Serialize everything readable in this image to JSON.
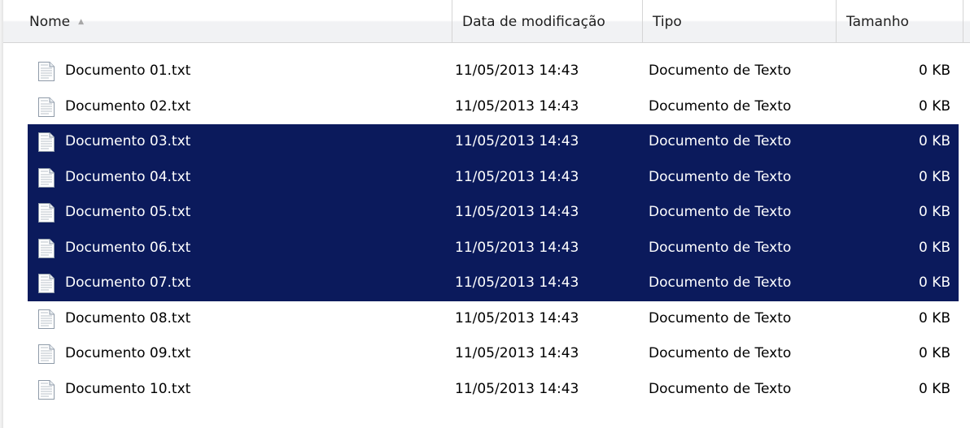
{
  "columns": {
    "name": "Nome",
    "date": "Data de modificação",
    "type": "Tipo",
    "size": "Tamanho"
  },
  "sort_indicator": "ascending",
  "files": [
    {
      "name": "Documento 01.txt",
      "date": "11/05/2013 14:43",
      "type": "Documento de Texto",
      "size": "0 KB",
      "selected": false
    },
    {
      "name": "Documento 02.txt",
      "date": "11/05/2013 14:43",
      "type": "Documento de Texto",
      "size": "0 KB",
      "selected": false
    },
    {
      "name": "Documento 03.txt",
      "date": "11/05/2013 14:43",
      "type": "Documento de Texto",
      "size": "0 KB",
      "selected": true
    },
    {
      "name": "Documento 04.txt",
      "date": "11/05/2013 14:43",
      "type": "Documento de Texto",
      "size": "0 KB",
      "selected": true
    },
    {
      "name": "Documento 05.txt",
      "date": "11/05/2013 14:43",
      "type": "Documento de Texto",
      "size": "0 KB",
      "selected": true
    },
    {
      "name": "Documento 06.txt",
      "date": "11/05/2013 14:43",
      "type": "Documento de Texto",
      "size": "0 KB",
      "selected": true
    },
    {
      "name": "Documento 07.txt",
      "date": "11/05/2013 14:43",
      "type": "Documento de Texto",
      "size": "0 KB",
      "selected": true
    },
    {
      "name": "Documento 08.txt",
      "date": "11/05/2013 14:43",
      "type": "Documento de Texto",
      "size": "0 KB",
      "selected": false
    },
    {
      "name": "Documento 09.txt",
      "date": "11/05/2013 14:43",
      "type": "Documento de Texto",
      "size": "0 KB",
      "selected": false
    },
    {
      "name": "Documento 10.txt",
      "date": "11/05/2013 14:43",
      "type": "Documento de Texto",
      "size": "0 KB",
      "selected": false
    }
  ],
  "colors": {
    "selection": "#0b1a5c",
    "selected_text": "#ffffff",
    "header_border": "#d5d5d5"
  },
  "icons": {
    "file": "text-document-icon",
    "sort": "sort-ascending-icon"
  }
}
